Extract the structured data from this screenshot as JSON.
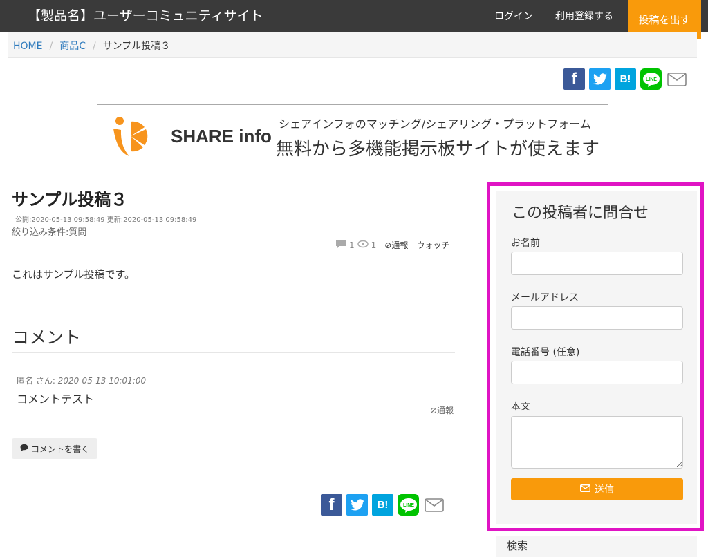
{
  "header": {
    "site_title": "【製品名】ユーザーコミュニティサイト",
    "login": "ログイン",
    "register": "利用登録する",
    "post_button": "投稿を出す"
  },
  "breadcrumb": {
    "home": "HOME",
    "category": "商品C",
    "current": "サンプル投稿３",
    "separator": "/"
  },
  "share_icons": [
    "facebook-icon",
    "twitter-icon",
    "hatena-bookmark-icon",
    "line-icon",
    "mail-icon"
  ],
  "share_labels": {
    "facebook": "f",
    "hatena": "B!",
    "line": "LINE"
  },
  "banner": {
    "brand": "SHARE info",
    "line1": "シェアインフォのマッチング/シェアリング・プラットフォーム",
    "line2": "無料から多機能掲示板サイトが使えます"
  },
  "post": {
    "title": "サンプル投稿３",
    "dates": "公開:2020-05-13 09:58:49 更新:2020-05-13 09:58:49",
    "filter": "絞り込み条件:質問",
    "comment_count": "1",
    "view_count": "1",
    "report": "通報",
    "watch": "ウォッチ",
    "body": "これはサンプル投稿です。"
  },
  "comments": {
    "heading": "コメント",
    "items": [
      {
        "author": "匿名 さん",
        "time": "2020-05-13 10:01:00",
        "text": "コメントテスト",
        "report": "通報"
      }
    ],
    "write_button": "コメントを書く"
  },
  "contact_form": {
    "title": "この投稿者に問合せ",
    "name_label": "お名前",
    "email_label": "メールアドレス",
    "phone_label": "電話番号 (任意)",
    "body_label": "本文",
    "submit": "送信"
  },
  "sidebar": {
    "search_title": "検索"
  },
  "colors": {
    "accent": "#f99a0b",
    "highlight_border": "#e014c4",
    "topbar": "#3a3a3a",
    "link": "#2f7bbd"
  }
}
